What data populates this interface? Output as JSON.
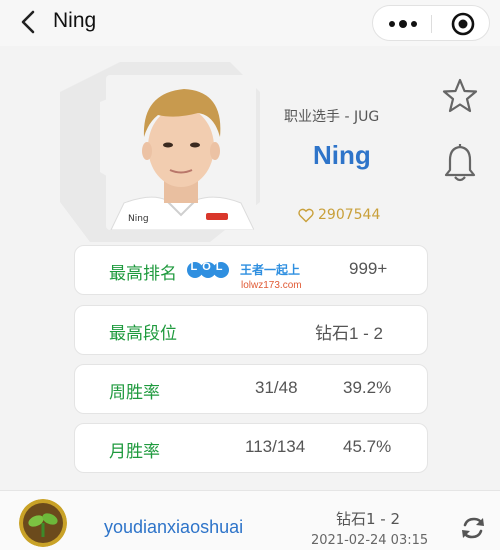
{
  "header": {
    "title": "Ning",
    "back_icon": "chevron-left-icon",
    "more_icon": "more-dots-icon",
    "close_icon": "record-target-icon"
  },
  "profile": {
    "role": "职业选手 - JUG",
    "name": "Ning",
    "likes": "2907544",
    "favorite_icon": "star-outline-icon",
    "subscribe_icon": "bell-outline-icon"
  },
  "stats": [
    {
      "label": "最高排名",
      "value": "999+"
    },
    {
      "label": "最高段位",
      "value": "钻石1 - 2"
    },
    {
      "label": "周胜率",
      "count": "31/48",
      "rate": "39.2%"
    },
    {
      "label": "月胜率",
      "count": "113/134",
      "rate": "45.7%"
    }
  ],
  "watermark": {
    "badge": "LOL",
    "text": "王者一起上",
    "url": "lolwz173.com"
  },
  "footer": {
    "username": "youdianxiaoshuai",
    "rank": "钻石1 - 2",
    "datetime": "2021-02-24 03:15",
    "refresh_icon": "refresh-icon"
  },
  "colors": {
    "accent_blue": "#2e74c9",
    "label_green": "#1f9a3e",
    "like_gold": "#c9a03b"
  }
}
